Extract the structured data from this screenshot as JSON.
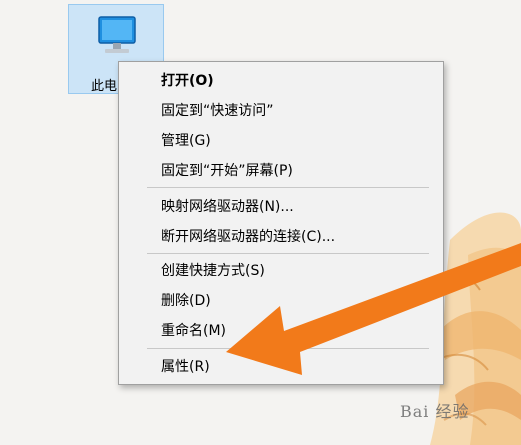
{
  "desktop": {
    "icon": {
      "name": "computer-icon",
      "label": "此电"
    }
  },
  "context_menu": {
    "items": [
      {
        "label": "打开(O)",
        "bold": true
      },
      {
        "label": "固定到“快速访问”"
      },
      {
        "label": "管理(G)"
      },
      {
        "label": "固定到“开始”屏幕(P)"
      },
      {
        "label": "映射网络驱动器(N)..."
      },
      {
        "label": "断开网络驱动器的连接(C)..."
      },
      {
        "label": "创建快捷方式(S)"
      },
      {
        "label": "删除(D)"
      },
      {
        "label": "重命名(M)"
      },
      {
        "label": "属性(R)"
      }
    ]
  },
  "annotation": {
    "arrow_color": "#f27a1a"
  },
  "watermark": {
    "text": "Bai 经验"
  }
}
